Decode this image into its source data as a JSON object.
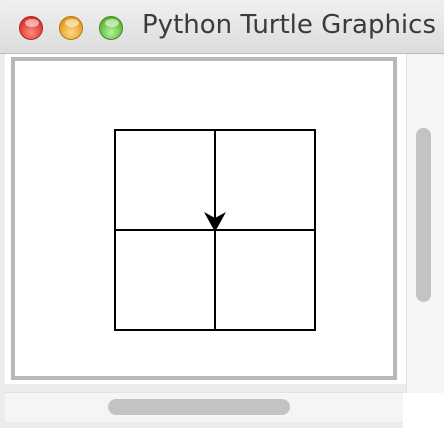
{
  "window": {
    "title": "Python Turtle Graphics",
    "buttons": {
      "close_color": "#d9352b",
      "minimize_color": "#e59a1c",
      "zoom_color": "#5ab530"
    }
  },
  "canvas": {
    "background": "#ffffff",
    "pen_color": "#000000",
    "drawing": "2x2 grid of squares",
    "turtle": {
      "shape": "arrow",
      "heading": "down",
      "color": "#000000"
    }
  },
  "scrollbars": {
    "vertical": "visible",
    "horizontal": "visible"
  }
}
